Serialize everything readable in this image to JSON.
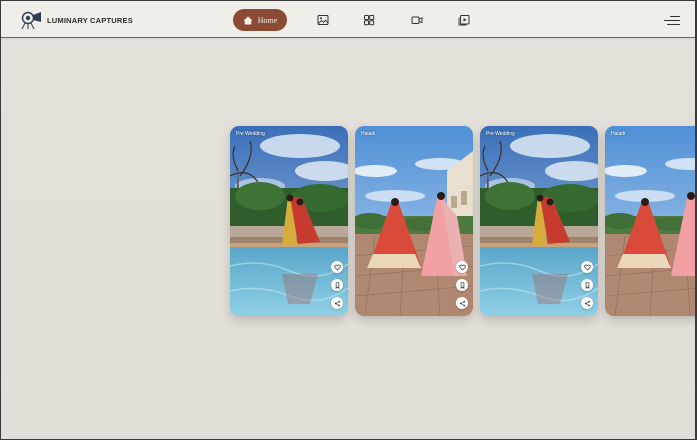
{
  "brand": {
    "name": "LUMINARY CAPTURES"
  },
  "nav": {
    "home_label": "Home",
    "icons": [
      "image-icon",
      "grid-icon",
      "video-icon",
      "play-gallery-icon"
    ]
  },
  "gallery": {
    "cards": [
      {
        "tag": "Pre Wedding",
        "scene": "pool"
      },
      {
        "tag": "Haladi",
        "scene": "courtyard"
      },
      {
        "tag": "Pre Wedding",
        "scene": "pool"
      },
      {
        "tag": "Haladi",
        "scene": "courtyard"
      }
    ]
  },
  "colors": {
    "accent": "#8b4a34",
    "page_bg": "#e4e0da",
    "header_bg": "#f0eee9"
  }
}
